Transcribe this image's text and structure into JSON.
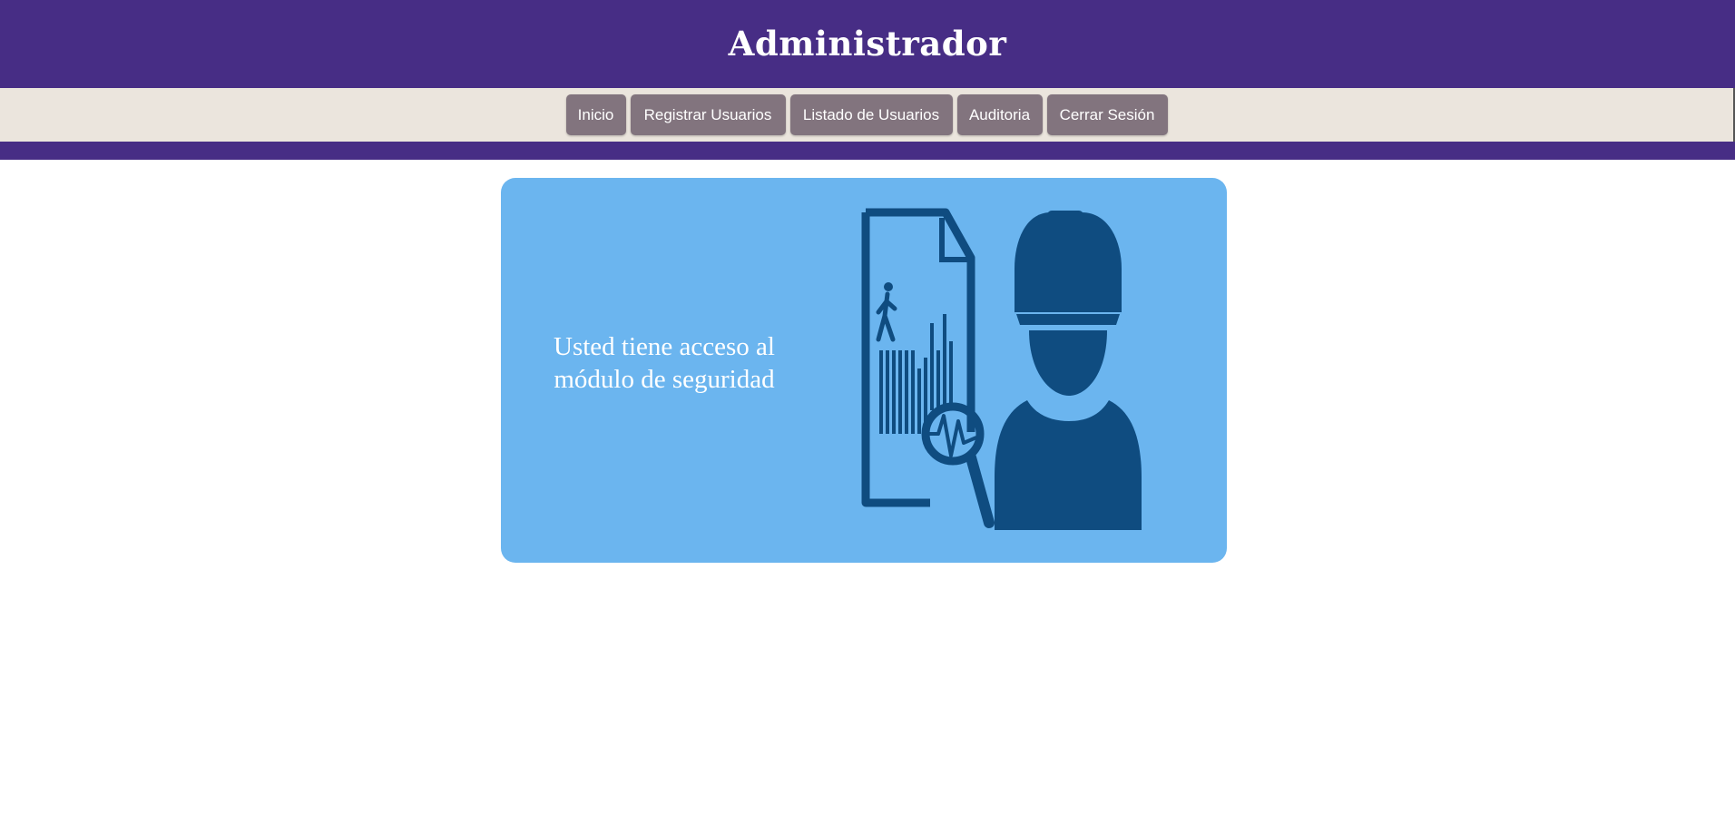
{
  "header": {
    "title": "Administrador"
  },
  "nav": {
    "items": [
      {
        "label": "Inicio"
      },
      {
        "label": "Registrar Usuarios"
      },
      {
        "label": "Listado de Usuarios"
      },
      {
        "label": "Auditoria"
      },
      {
        "label": "Cerrar Sesión"
      }
    ]
  },
  "card": {
    "message": "Usted tiene acceso al módulo de seguridad",
    "illustration_icon": "security-worker-audit-icon"
  },
  "colors": {
    "header_bg": "#472d85",
    "nav_bg": "#ebe5dd",
    "button_bg": "#82747e",
    "card_bg": "#6bb5ef",
    "illustration": "#0f4c80"
  }
}
